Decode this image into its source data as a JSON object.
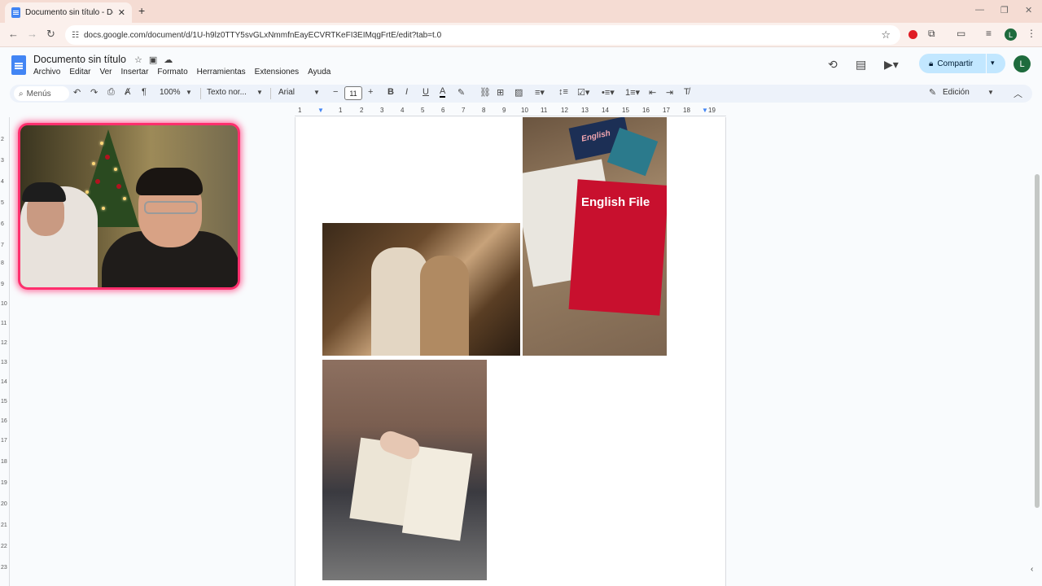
{
  "browser": {
    "tab_title": "Documento sin título - Docume",
    "url": "docs.google.com/document/d/1U-h9lz0TTY5svGLxNmmfnEayECVRTKeFI3EIMqgFrtE/edit?tab=t.0",
    "profile_initial": "L"
  },
  "docs": {
    "title": "Documento sin título",
    "menu": [
      "Archivo",
      "Editar",
      "Ver",
      "Insertar",
      "Formato",
      "Herramientas",
      "Extensiones",
      "Ayuda"
    ],
    "share_label": "Compartir",
    "avatar_initial": "L"
  },
  "toolbar": {
    "search_label": "Menús",
    "zoom": "100%",
    "style": "Texto nor...",
    "font": "Arial",
    "font_size": "11",
    "mode": "Edición"
  },
  "ruler": {
    "marks": [
      "1",
      "1",
      "2",
      "3",
      "4",
      "5",
      "6",
      "7",
      "8",
      "9",
      "10",
      "11",
      "12",
      "13",
      "14",
      "15",
      "16",
      "17",
      "18",
      "19"
    ]
  },
  "vruler": {
    "marks": [
      "2",
      "3",
      "4",
      "5",
      "6",
      "7",
      "8",
      "9",
      "10",
      "11",
      "12",
      "13",
      "14",
      "15",
      "16",
      "17",
      "18",
      "19",
      "20",
      "21",
      "22",
      "23"
    ]
  },
  "document": {
    "book_cover_text": "English File",
    "book_small_text": "English"
  },
  "colors": {
    "accent": "#c2e7ff",
    "webcam_border": "#ff2f6d",
    "avatar": "#1e6b3d"
  }
}
